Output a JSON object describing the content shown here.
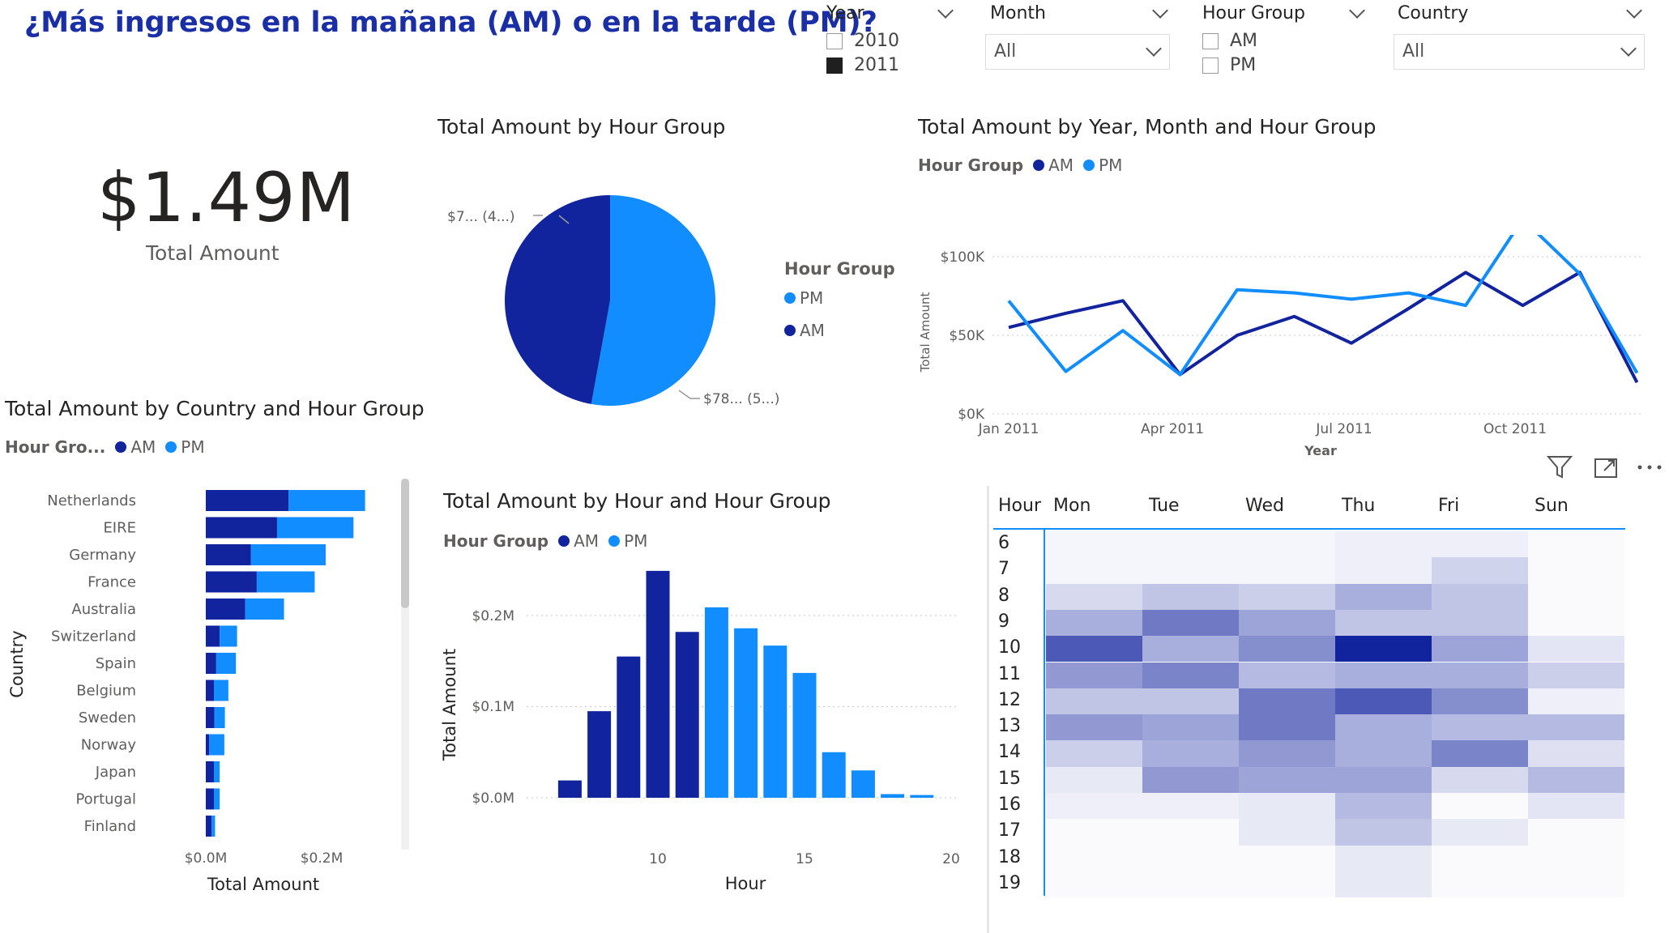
{
  "report_title": "¿Más ingresos en la mañana (AM) o en la tarde (PM)?",
  "colors": {
    "am": "#12239e",
    "pm": "#118dff",
    "title": "#1a2ea6"
  },
  "slicers": {
    "year": {
      "title": "Year",
      "options": [
        {
          "label": "2010",
          "checked": false
        },
        {
          "label": "2011",
          "checked": true
        }
      ]
    },
    "month": {
      "title": "Month",
      "value": "All"
    },
    "hour_group": {
      "title": "Hour Group",
      "options": [
        {
          "label": "AM",
          "checked": false
        },
        {
          "label": "PM",
          "checked": false
        }
      ]
    },
    "country": {
      "title": "Country",
      "value": "All"
    }
  },
  "card": {
    "value": "$1.49M",
    "label": "Total Amount"
  },
  "pie": {
    "title": "Total Amount by Hour Group",
    "legend_title": "Hour Group",
    "legend": [
      "PM",
      "AM"
    ],
    "label_am": "$7... (4...)",
    "label_pm": "$78... (5...)"
  },
  "line": {
    "title": "Total Amount by Year, Month and Hour Group",
    "legend_title": "Hour Group",
    "legend": [
      "AM",
      "PM"
    ],
    "ylabel": "Total Amount",
    "xlabel": "Year",
    "yticks": [
      "$0K",
      "$50K",
      "$100K"
    ],
    "xticks": [
      "Jan 2011",
      "Apr 2011",
      "Jul 2011",
      "Oct 2011"
    ]
  },
  "bar": {
    "title": "Total Amount by Country and Hour Group",
    "legend_title": "Hour Gro...",
    "legend": [
      "AM",
      "PM"
    ],
    "ylabel": "Country",
    "xlabel": "Total Amount",
    "xticks": [
      "$0.0M",
      "$0.2M"
    ]
  },
  "column": {
    "title": "Total Amount by Hour and Hour Group",
    "legend_title": "Hour Group",
    "legend": [
      "AM",
      "PM"
    ],
    "ylabel": "Total Amount",
    "xlabel": "Hour",
    "yticks": [
      "$0.0M",
      "$0.1M",
      "$0.2M"
    ],
    "xticks": [
      "10",
      "15",
      "20"
    ]
  },
  "heatmap": {
    "corner": "Hour",
    "days": [
      "Mon",
      "Tue",
      "Wed",
      "Thu",
      "Fri",
      "Sun"
    ],
    "hours": [
      "6",
      "7",
      "8",
      "9",
      "10",
      "11",
      "12",
      "13",
      "14",
      "15",
      "16",
      "17",
      "18",
      "19"
    ]
  },
  "chart_data": [
    {
      "type": "pie",
      "title": "Total Amount by Hour Group",
      "categories": [
        "AM",
        "PM"
      ],
      "values": [
        700000,
        785000
      ]
    },
    {
      "type": "line",
      "title": "Total Amount by Year, Month and Hour Group",
      "x": [
        "Jan 2011",
        "Feb 2011",
        "Mar 2011",
        "Apr 2011",
        "May 2011",
        "Jun 2011",
        "Jul 2011",
        "Aug 2011",
        "Sep 2011",
        "Oct 2011",
        "Nov 2011",
        "Dec 2011"
      ],
      "series": [
        {
          "name": "AM",
          "values": [
            55000,
            64000,
            72000,
            25000,
            50000,
            62000,
            45000,
            67000,
            90000,
            69000,
            90000,
            20000
          ]
        },
        {
          "name": "PM",
          "values": [
            72000,
            27000,
            53000,
            25000,
            79000,
            77000,
            73000,
            77000,
            69000,
            124000,
            89000,
            26000
          ]
        }
      ],
      "xlabel": "Year",
      "ylabel": "Total Amount",
      "ylim": [
        0,
        130000
      ]
    },
    {
      "type": "bar",
      "title": "Total Amount by Country and Hour Group",
      "categories": [
        "Netherlands",
        "EIRE",
        "Germany",
        "France",
        "Australia",
        "Switzerland",
        "Spain",
        "Belgium",
        "Sweden",
        "Norway",
        "Japan",
        "Portugal",
        "Finland"
      ],
      "series": [
        {
          "name": "AM",
          "values": [
            0.143,
            0.123,
            0.078,
            0.088,
            0.068,
            0.024,
            0.018,
            0.014,
            0.015,
            0.006,
            0.014,
            0.014,
            0.01
          ]
        },
        {
          "name": "PM",
          "values": [
            0.132,
            0.132,
            0.129,
            0.1,
            0.067,
            0.03,
            0.034,
            0.025,
            0.018,
            0.026,
            0.01,
            0.01,
            0.006
          ]
        }
      ],
      "xlabel": "Total Amount",
      "ylabel": "Country",
      "xlim": [
        0,
        0.33
      ]
    },
    {
      "type": "bar",
      "title": "Total Amount by Hour and Hour Group",
      "categories": [
        "7",
        "8",
        "9",
        "10",
        "11",
        "12",
        "13",
        "14",
        "15",
        "16",
        "17",
        "18",
        "19"
      ],
      "series": [
        {
          "name": "AM",
          "values": [
            0.019,
            0.095,
            0.155,
            0.249,
            0.182,
            0,
            0,
            0,
            0,
            0,
            0,
            0,
            0
          ]
        },
        {
          "name": "PM",
          "values": [
            0,
            0,
            0,
            0,
            0,
            0.209,
            0.186,
            0.167,
            0.137,
            0.05,
            0.03,
            0.004,
            0.003
          ]
        }
      ],
      "xlabel": "Hour",
      "ylabel": "Total Amount",
      "ylim": [
        0,
        0.26
      ]
    },
    {
      "type": "heatmap",
      "x": [
        "Mon",
        "Tue",
        "Wed",
        "Thu",
        "Fri",
        "Sun"
      ],
      "y": [
        "6",
        "7",
        "8",
        "9",
        "10",
        "11",
        "12",
        "13",
        "14",
        "15",
        "16",
        "17",
        "18",
        "19"
      ],
      "values": [
        [
          0.02,
          0.02,
          0.02,
          0.05,
          0.05,
          0
        ],
        [
          0.02,
          0.02,
          0.02,
          0.05,
          0.18,
          0
        ],
        [
          0.15,
          0.25,
          0.2,
          0.35,
          0.25,
          0
        ],
        [
          0.35,
          0.6,
          0.4,
          0.25,
          0.25,
          0
        ],
        [
          0.75,
          0.35,
          0.5,
          1.0,
          0.4,
          0.1
        ],
        [
          0.45,
          0.55,
          0.3,
          0.35,
          0.35,
          0.2
        ],
        [
          0.25,
          0.25,
          0.6,
          0.75,
          0.5,
          0.05
        ],
        [
          0.45,
          0.4,
          0.6,
          0.35,
          0.3,
          0.3
        ],
        [
          0.2,
          0.35,
          0.45,
          0.35,
          0.55,
          0.12
        ],
        [
          0.08,
          0.45,
          0.4,
          0.4,
          0.15,
          0.3
        ],
        [
          0.05,
          0.05,
          0.08,
          0.3,
          0,
          0.1
        ],
        [
          0,
          0,
          0.08,
          0.25,
          0.08,
          0
        ],
        [
          0,
          0,
          0,
          0.08,
          0,
          0
        ],
        [
          0,
          0,
          0,
          0.08,
          0,
          0
        ]
      ]
    }
  ]
}
